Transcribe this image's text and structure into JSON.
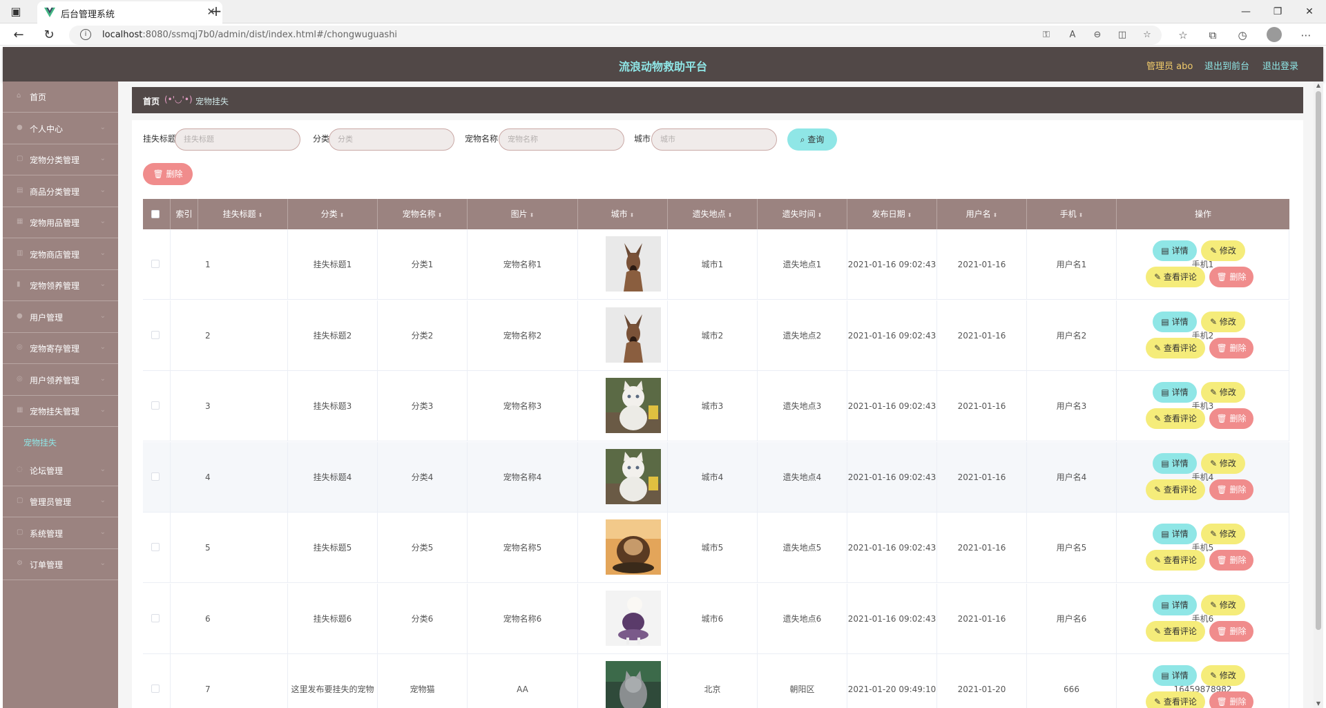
{
  "browser": {
    "tab_title": "后台管理系统",
    "tab_close": "✕",
    "new_tab": "+",
    "url_host": "localhost",
    "url_rest": ":8080/ssmqj7b0/admin/dist/index.html#/chongwuguashi",
    "info_icon": "i"
  },
  "header": {
    "title": "流浪动物救助平台",
    "admin": "管理员 abo",
    "front": "退出到前台",
    "logout": "退出登录"
  },
  "sidebar": {
    "items": [
      {
        "label": "首页",
        "icon": "⌂"
      },
      {
        "label": "个人中心",
        "icon": "●"
      },
      {
        "label": "宠物分类管理",
        "icon": "▢"
      },
      {
        "label": "商品分类管理",
        "icon": "▤"
      },
      {
        "label": "宠物用品管理",
        "icon": "▦"
      },
      {
        "label": "宠物商店管理",
        "icon": "▥"
      },
      {
        "label": "宠物领养管理",
        "icon": "▮"
      },
      {
        "label": "用户管理",
        "icon": "●"
      },
      {
        "label": "宠物寄存管理",
        "icon": "◎"
      },
      {
        "label": "用户领养管理",
        "icon": "◎"
      },
      {
        "label": "宠物挂失管理",
        "icon": "▦"
      }
    ],
    "sub_item": "宠物挂失",
    "items_after": [
      {
        "label": "论坛管理",
        "icon": "◌"
      },
      {
        "label": "管理员管理",
        "icon": "▢"
      },
      {
        "label": "系统管理",
        "icon": "▢"
      },
      {
        "label": "订单管理",
        "icon": "⚙"
      }
    ],
    "arrow": "⌄"
  },
  "breadcrumb": {
    "home": "首页",
    "sep": "(•'◡'•)",
    "current": "宠物挂失"
  },
  "search": {
    "title_label": "挂失标题",
    "title_placeholder": "挂失标题",
    "category_label": "分类",
    "category_placeholder": "分类",
    "petname_label": "宠物名称",
    "petname_placeholder": "宠物名称",
    "city_label": "城市",
    "city_placeholder": "城市",
    "query_button": "⌕ 查询",
    "batch_delete": "🗑 删除"
  },
  "table": {
    "headers": [
      "索引",
      "挂失标题",
      "分类",
      "宠物名称",
      "图片",
      "城市",
      "遗失地点",
      "遗失时间",
      "发布日期",
      "用户名",
      "手机",
      "操作"
    ],
    "sort_glyph": "⬍",
    "actions": {
      "detail": "▤ 详情",
      "edit": "✎ 修改",
      "comment": "✎ 查看评论",
      "delete": "🗑 删除"
    },
    "rows": [
      {
        "index": "1",
        "title": "挂失标题1",
        "category": "分类1",
        "petname": "宠物名称1",
        "pic": "dog",
        "city": "城市1",
        "place": "遗失地点1",
        "time": "2021-01-16 09:02:43",
        "date": "2021-01-16",
        "user": "用户名1",
        "phone": "手机1"
      },
      {
        "index": "2",
        "title": "挂失标题2",
        "category": "分类2",
        "petname": "宠物名称2",
        "pic": "dog",
        "city": "城市2",
        "place": "遗失地点2",
        "time": "2021-01-16 09:02:43",
        "date": "2021-01-16",
        "user": "用户名2",
        "phone": "手机2"
      },
      {
        "index": "3",
        "title": "挂失标题3",
        "category": "分类3",
        "petname": "宠物名称3",
        "pic": "kitten",
        "city": "城市3",
        "place": "遗失地点3",
        "time": "2021-01-16 09:02:43",
        "date": "2021-01-16",
        "user": "用户名3",
        "phone": "手机3"
      },
      {
        "index": "4",
        "title": "挂失标题4",
        "category": "分类4",
        "petname": "宠物名称4",
        "pic": "kitten",
        "city": "城市4",
        "place": "遗失地点4",
        "time": "2021-01-16 09:02:43",
        "date": "2021-01-16",
        "user": "用户名4",
        "phone": "手机4"
      },
      {
        "index": "5",
        "title": "挂失标题5",
        "category": "分类5",
        "petname": "宠物名称5",
        "pic": "puppy",
        "city": "城市5",
        "place": "遗失地点5",
        "time": "2021-01-16 09:02:43",
        "date": "2021-01-16",
        "user": "用户名5",
        "phone": "手机5"
      },
      {
        "index": "6",
        "title": "挂失标题6",
        "category": "分类6",
        "petname": "宠物名称6",
        "pic": "poodle",
        "city": "城市6",
        "place": "遗失地点6",
        "time": "2021-01-16 09:02:43",
        "date": "2021-01-16",
        "user": "用户名6",
        "phone": "手机6"
      },
      {
        "index": "7",
        "title": "这里发布要挂失的宠物",
        "category": "宠物猫",
        "petname": "AA",
        "pic": "cat",
        "city": "北京",
        "place": "朝阳区",
        "time": "2021-01-20 09:49:10",
        "date": "2021-01-20",
        "user": "666",
        "phone": "16459878982"
      }
    ]
  },
  "colors": {
    "header_bg": "#514847",
    "sidebar_bg": "#9b8380",
    "accent_cyan": "#8fe6e6",
    "accent_yellow": "#f5ec7a",
    "danger": "#f08c8c"
  }
}
